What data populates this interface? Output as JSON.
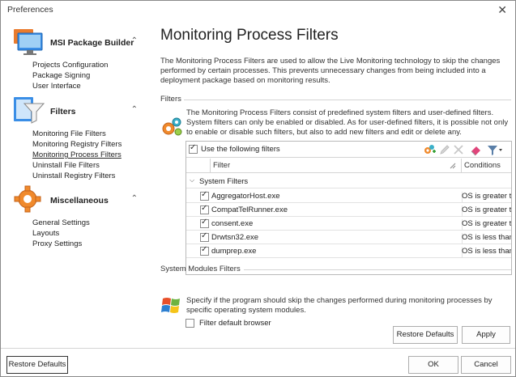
{
  "window": {
    "title": "Preferences",
    "close_glyph": "✕"
  },
  "sidebar": {
    "categories": [
      {
        "title": "MSI Package Builder",
        "icon": "monitor-icon",
        "items": [
          "Projects Configuration",
          "Package Signing",
          "User Interface"
        ]
      },
      {
        "title": "Filters",
        "icon": "funnel-icon",
        "items": [
          "Monitoring File Filters",
          "Monitoring Registry Filters",
          "Monitoring Process Filters",
          "Uninstall File Filters",
          "Uninstall Registry Filters"
        ]
      },
      {
        "title": "Miscellaneous",
        "icon": "gear-icon",
        "items": [
          "General Settings",
          "Layouts",
          "Proxy Settings"
        ]
      }
    ],
    "active_item": "Monitoring Process Filters",
    "chevron_glyph": "⌃"
  },
  "main": {
    "title": "Monitoring Process Filters",
    "description": "The Monitoring Process Filters are used to allow the Live Monitoring technology to skip the changes performed by certain processes. This prevents unnecessary changes from being included into a deployment package based on monitoring results.",
    "filters_section": {
      "label": "Filters",
      "text": "The Monitoring Process Filters consist of predefined system filters and user-defined filters. System filters can only be enabled or disabled. As for user-defined filters, it is possible not only to enable or disable such filters, but also to add new filters and edit or delete any."
    },
    "grid": {
      "toolbar_label": "Use the following filters",
      "toolbar_checked": true,
      "columns": [
        "Filter",
        "Conditions"
      ],
      "group_label": "System Filters",
      "rows": [
        {
          "name": "AggregatorHost.exe",
          "condition": "OS is greater th",
          "checked": true
        },
        {
          "name": "CompatTelRunner.exe",
          "condition": "OS is greater th",
          "checked": true
        },
        {
          "name": "consent.exe",
          "condition": "OS is greater th",
          "checked": true
        },
        {
          "name": "Drwtsn32.exe",
          "condition": "OS is less than",
          "checked": true
        },
        {
          "name": "dumprep.exe",
          "condition": "OS is less than",
          "checked": true
        }
      ]
    },
    "system_modules": {
      "label": "System Modules Filters",
      "text": "Specify if the program should skip the changes performed during monitoring processes by specific operating system modules.",
      "checkbox_label": "Filter default browser",
      "checked": false
    },
    "buttons": {
      "restore_defaults": "Restore Defaults",
      "apply": "Apply"
    }
  },
  "footer": {
    "restore_defaults": "Restore Defaults",
    "ok": "OK",
    "cancel": "Cancel"
  },
  "colors": {
    "border": "#adadad",
    "accent_orange": "#e8712a",
    "accent_blue": "#2c7fd1"
  }
}
